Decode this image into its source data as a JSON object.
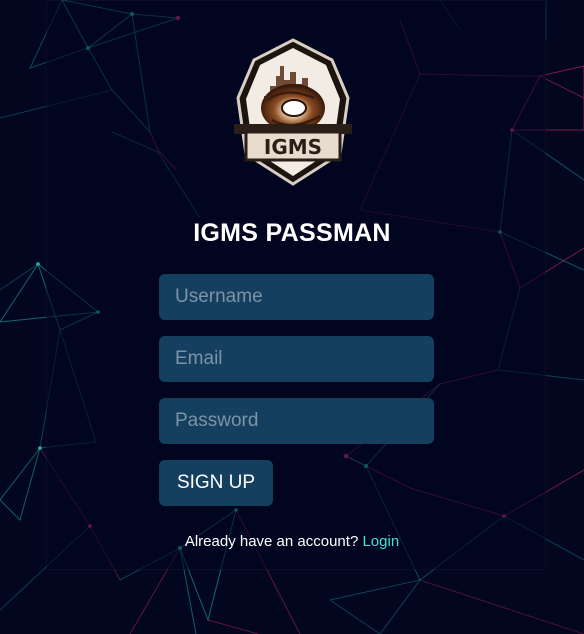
{
  "brand": {
    "logo_text": "IGMS",
    "app_title": "IGMS PASSMAN"
  },
  "form": {
    "username_placeholder": "Username",
    "email_placeholder": "Email",
    "password_placeholder": "Password",
    "submit_label": "SIGN UP"
  },
  "footer": {
    "prompt": "Already have an account?",
    "login_label": "Login"
  },
  "colors": {
    "background": "#02061f",
    "field_bg": "#143f5e",
    "link": "#3ee2d6",
    "network_teal": "#1fb9b0",
    "network_pink": "#d8266c"
  }
}
